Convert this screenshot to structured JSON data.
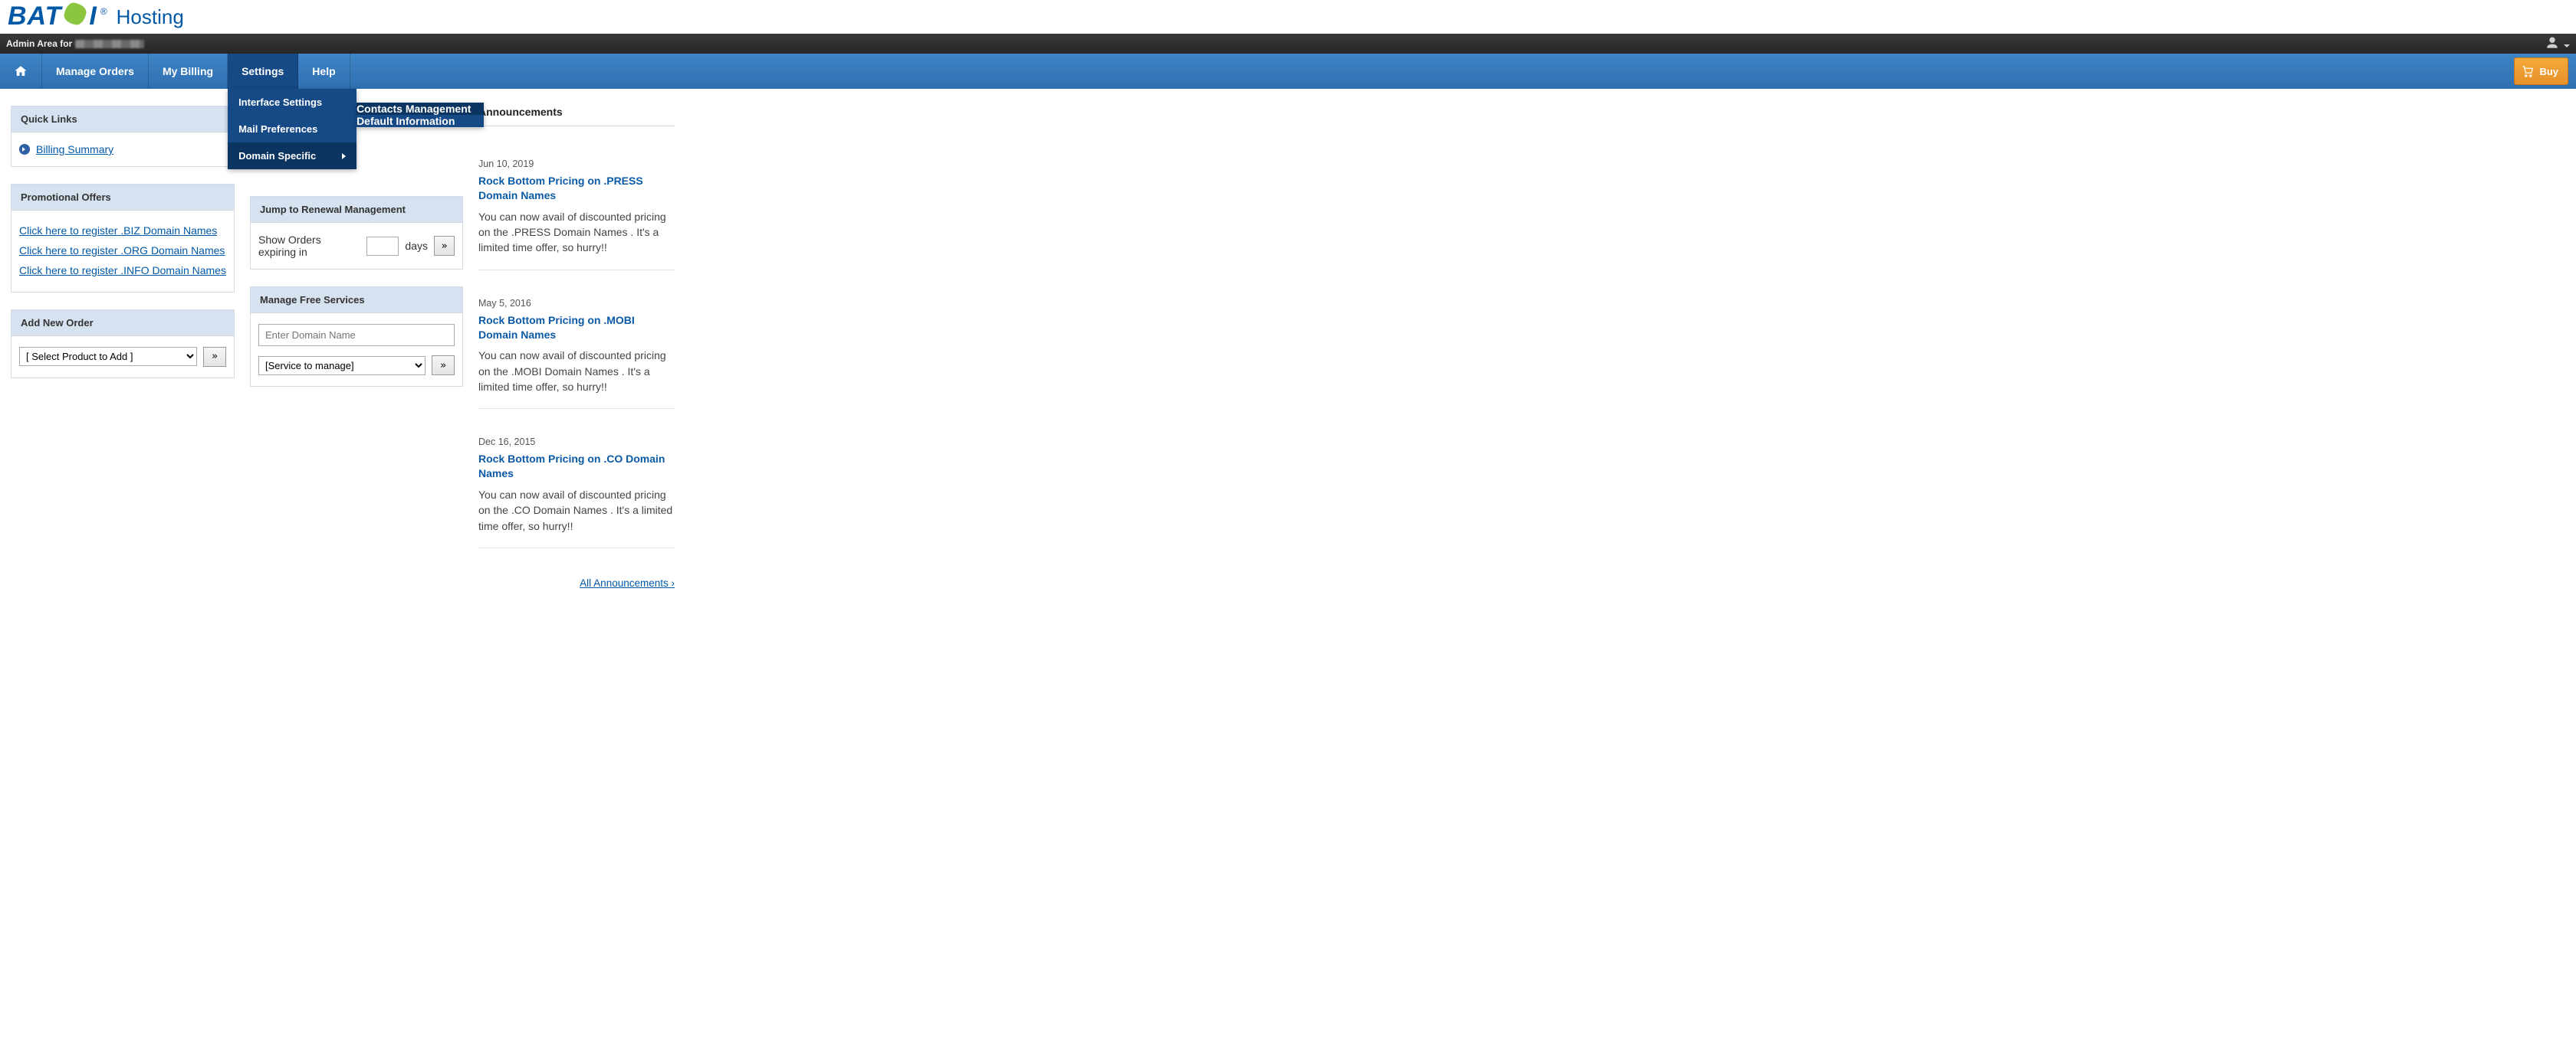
{
  "brand": {
    "word1": "BAT",
    "word2": "I",
    "reg": "®",
    "sub": "Hosting"
  },
  "admin_bar": {
    "prefix": "Admin Area for"
  },
  "nav": {
    "items": [
      {
        "label": "Manage Orders"
      },
      {
        "label": "My Billing"
      },
      {
        "label": "Settings"
      },
      {
        "label": "Help"
      }
    ],
    "buy_label": "Buy"
  },
  "settings_menu": {
    "items": [
      {
        "label": "Interface Settings"
      },
      {
        "label": "Mail Preferences"
      },
      {
        "label": "Domain Specific"
      }
    ],
    "submenu": [
      {
        "label": "Contacts Management"
      },
      {
        "label": "Default Information"
      }
    ]
  },
  "quick_links": {
    "title": "Quick Links",
    "billing_summary": "Billing Summary"
  },
  "promos": {
    "title": "Promotional Offers",
    "links": [
      "Click here to register .BIZ Domain Names",
      "Click here to register .ORG Domain Names",
      "Click here to register .INFO Domain Names"
    ]
  },
  "add_order": {
    "title": "Add New Order",
    "select_placeholder": "[ Select Product to Add ]",
    "go": "»"
  },
  "renewal": {
    "title": "Jump to Renewal Management",
    "pre": "Show Orders expiring in",
    "post": "days",
    "go": "»"
  },
  "free_services": {
    "title": "Manage Free Services",
    "domain_placeholder": "Enter Domain Name",
    "service_placeholder": "[Service to manage]",
    "go": "»"
  },
  "announcements": {
    "title": "Announcements",
    "items": [
      {
        "date": "Jun 10, 2019",
        "title": "Rock Bottom Pricing on .PRESS Domain Names",
        "body": "You can now avail of discounted pricing on the .PRESS Domain Names . It's a limited time offer, so hurry!!"
      },
      {
        "date": "May 5, 2016",
        "title": "Rock Bottom Pricing on .MOBI Domain Names",
        "body": "You can now avail of discounted pricing on the .MOBI Domain Names . It's a limited time offer, so hurry!!"
      },
      {
        "date": "Dec 16, 2015",
        "title": "Rock Bottom Pricing on .CO Domain Names",
        "body": "You can now avail of discounted pricing on the .CO Domain Names . It's a limited time offer, so hurry!!"
      }
    ],
    "all_link": "All Announcements ›"
  }
}
